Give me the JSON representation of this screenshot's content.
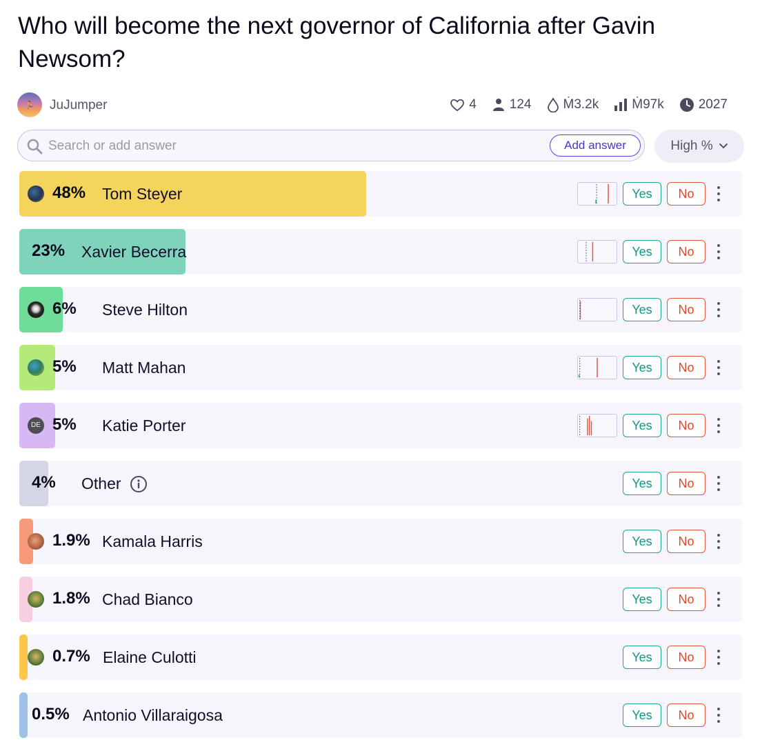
{
  "question": {
    "title": "Who will become the next governor of California after Gavin Newsom?"
  },
  "creator": {
    "name": "JuJumper"
  },
  "stats": {
    "likes": "4",
    "traders": "124",
    "liquidity": "Ṁ3.2k",
    "volume": "Ṁ97k",
    "close": "2027"
  },
  "search": {
    "placeholder": "Search or add answer",
    "add_answer_label": "Add answer"
  },
  "sort": {
    "selected": "High %"
  },
  "actions": {
    "yes_label": "Yes",
    "no_label": "No"
  },
  "answers": [
    {
      "name": "Tom Steyer",
      "prob_text": "48%",
      "probability": 48,
      "color": "#f4d45a",
      "avatar": "photo"
    },
    {
      "name": "Xavier Becerra",
      "prob_text": "23%",
      "probability": 23,
      "color": "#7fd3bb",
      "avatar": "none"
    },
    {
      "name": "Steve Hilton",
      "prob_text": "6%",
      "probability": 6,
      "color": "#6fdc9a",
      "avatar": "photo"
    },
    {
      "name": "Matt Mahan",
      "prob_text": "5%",
      "probability": 5,
      "color": "#b4ea7a",
      "avatar": "photo"
    },
    {
      "name": "Katie Porter",
      "prob_text": "5%",
      "probability": 5,
      "color": "#d6b8f4",
      "avatar": "initials",
      "avatar_initials": "DE"
    },
    {
      "name": "Other",
      "prob_text": "4%",
      "probability": 4,
      "color": "#d4d6e6",
      "avatar": "none"
    },
    {
      "name": "Kamala Harris",
      "prob_text": "1.9%",
      "probability": 1.9,
      "color": "#f79a7a",
      "avatar": "photo"
    },
    {
      "name": "Chad Bianco",
      "prob_text": "1.8%",
      "probability": 1.8,
      "color": "#f7cfe3",
      "avatar": "photo"
    },
    {
      "name": "Elaine Culotti",
      "prob_text": "0.7%",
      "probability": 0.7,
      "color": "#fbc74a",
      "avatar": "photo"
    },
    {
      "name": "Antonio Villaraigosa",
      "prob_text": "0.5%",
      "probability": 0.5,
      "color": "#9fc3e8",
      "avatar": "none"
    }
  ],
  "colors": {
    "yes": "#19a58e",
    "no": "#e2553b",
    "accent": "#4f46e5"
  }
}
